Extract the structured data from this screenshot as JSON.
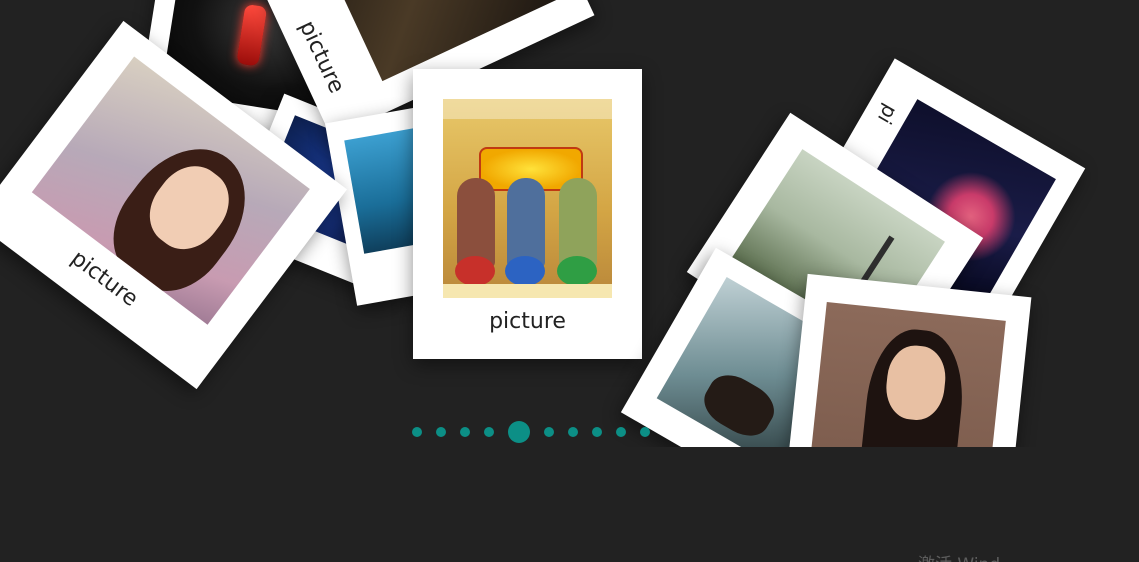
{
  "gallery": {
    "cards": [
      {
        "id": "car",
        "caption": ""
      },
      {
        "id": "warrior",
        "caption": "picture"
      },
      {
        "id": "girl",
        "caption": "picture"
      },
      {
        "id": "blue",
        "caption": ""
      },
      {
        "id": "sea",
        "caption": ""
      },
      {
        "id": "poster",
        "caption": "picture"
      },
      {
        "id": "night",
        "caption": "pi"
      },
      {
        "id": "paris",
        "caption": ""
      },
      {
        "id": "man",
        "caption": ""
      },
      {
        "id": "lady",
        "caption": ""
      }
    ],
    "pagination": {
      "count": 10,
      "active_index": 4
    }
  },
  "colors": {
    "background": "#222222",
    "card": "#ffffff",
    "accent": "#0c8f86"
  },
  "watermark": {
    "text": "激活 Wind"
  }
}
